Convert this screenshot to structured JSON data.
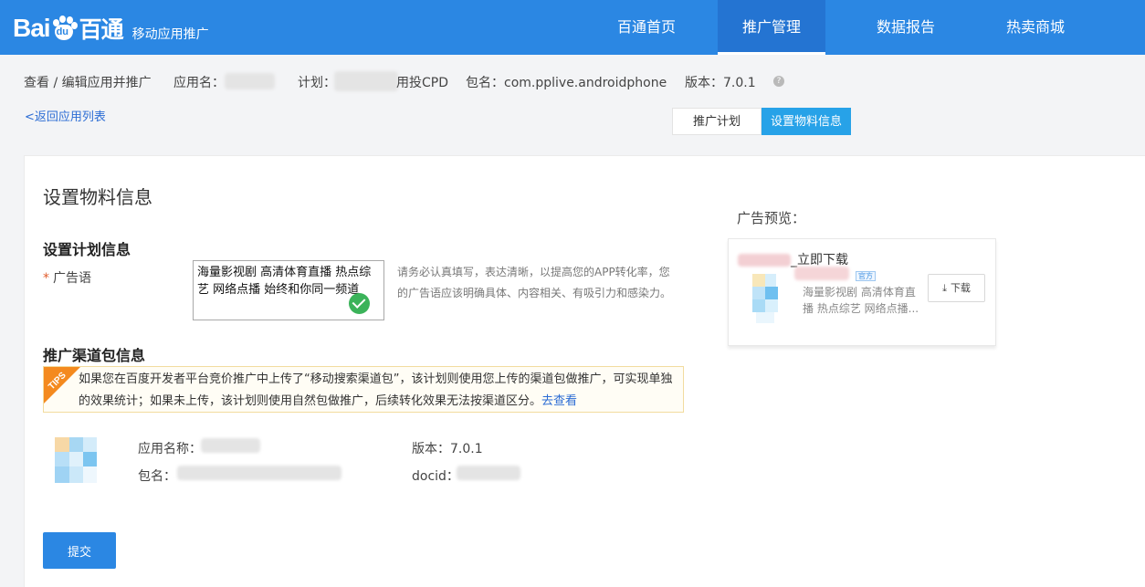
{
  "brand": {
    "logo_text_left": "Bai",
    "logo_text_mid": "du",
    "logo_text_cn": "百通",
    "subtitle": "移动应用推广"
  },
  "nav": {
    "items": [
      {
        "label": "百通首页",
        "active": false
      },
      {
        "label": "推广管理",
        "active": true
      },
      {
        "label": "数据报告",
        "active": false
      },
      {
        "label": "热卖商城",
        "active": false
      }
    ]
  },
  "info": {
    "breadcrumb": "查看 / 编辑应用并推广",
    "app_name_label": "应用名：",
    "plan_label": "计划：",
    "plan_suffix": "用投CPD",
    "package_label": "包名：com.pplive.androidphone",
    "version_label": "版本：7.0.1",
    "help_icon": "question-icon"
  },
  "back_link": "<返回应用列表",
  "tabs": [
    {
      "label": "推广计划",
      "active": false
    },
    {
      "label": "设置物料信息",
      "active": true
    }
  ],
  "main": {
    "page_title": "设置物料信息",
    "plan_section_title": "设置计划信息",
    "ad_label_required": "*",
    "ad_label": "广告语",
    "ad_value": "海量影视剧 高清体育直播 热点综艺 网络点播 始终和你同一频道",
    "hint": "请务必认真填写，表达清晰，以提高您的APP转化率，您的广告语应该明确具体、内容相关、有吸引力和感染力。",
    "channel_section_title": "推广渠道包信息",
    "tips_badge": "TIPS",
    "tips_text": "如果您在百度开发者平台竞价推广中上传了“移动搜索渠道包”，该计划则使用您上传的渠道包做推广，可实现单独的效果统计；如果未上传，该计划则使用自然包做推广，后续转化效果无法按渠道区分。",
    "tips_link": "去查看",
    "app_name_field": "应用名称：",
    "package_field": "包名：",
    "version_field": "版本：7.0.1",
    "docid_field": "docid："
  },
  "submit_label": "提交",
  "preview": {
    "title": "广告预览：",
    "heading_suffix": "_立即下载",
    "official_badge": "官方",
    "description": "海量影视剧 高清体育直播 热点综艺 网络点播...",
    "download_label": "下载",
    "download_icon": "download-icon"
  },
  "colors": {
    "nav_bg": "#2b87e3",
    "tab_active": "#27a2e8",
    "submit_bg": "#2b87e3",
    "success": "#3bb35a",
    "tips_ribbon": "#f48a1f",
    "link": "#2b6cd4"
  }
}
